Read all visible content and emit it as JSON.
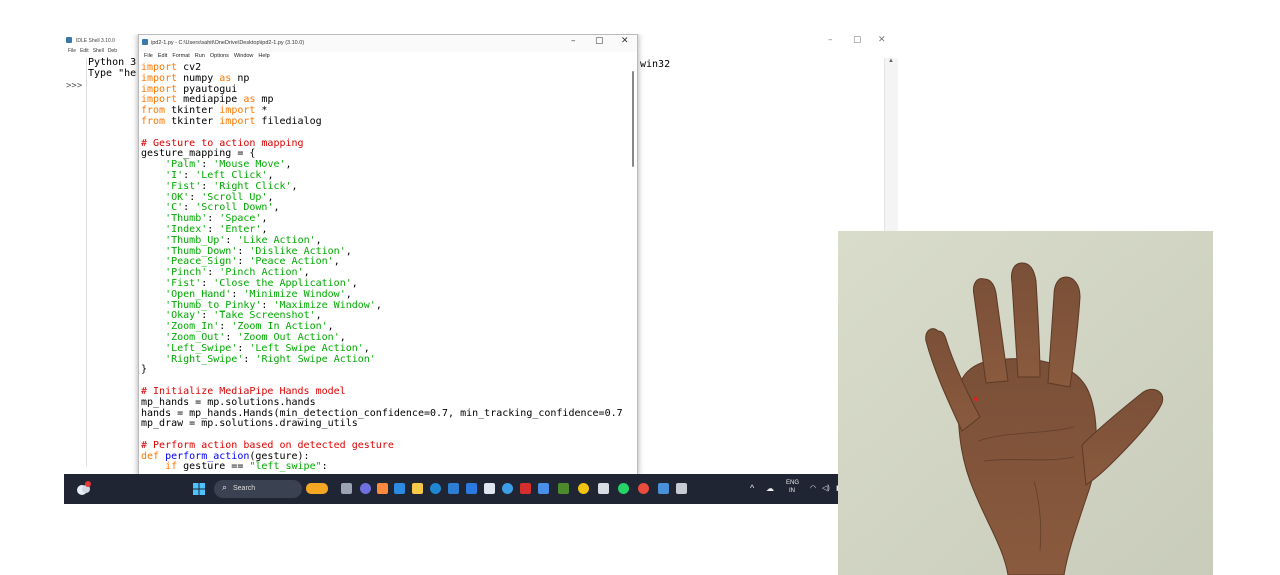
{
  "shell": {
    "title": "IDLE Shell 3.10.0",
    "menu": [
      "File",
      "Edit",
      "Shell",
      "Deb"
    ],
    "lines": [
      "Python 3",
      "Type \"he"
    ],
    "line_tail": "win32",
    "prompt": ">>>",
    "controls": {
      "minimize": "–",
      "maximize": "▢",
      "close": "✕"
    }
  },
  "editor": {
    "title": "ipd2-1.py - C:\\Users\\sahit\\OneDrive\\Desktop\\ipd2-1.py (3.10.0)",
    "menu": [
      "File",
      "Edit",
      "Format",
      "Run",
      "Options",
      "Window",
      "Help"
    ],
    "controls": {
      "minimize": "–",
      "maximize": "▢",
      "close": "✕"
    },
    "code": {
      "l1_kw": "import",
      "l1_rest": " cv2",
      "l2_kw": "import",
      "l2_mid": " numpy ",
      "l2_kw2": "as",
      "l2_rest": " np",
      "l3_kw": "import",
      "l3_rest": " pyautogui",
      "l4_kw": "import",
      "l4_mid": " mediapipe ",
      "l4_kw2": "as",
      "l4_rest": " mp",
      "l5_kw": "from",
      "l5_mid": " tkinter ",
      "l5_kw2": "import",
      "l5_rest": " *",
      "l6_kw": "from",
      "l6_mid": " tkinter ",
      "l6_kw2": "import",
      "l6_rest": " filedialog",
      "c1": "# Gesture to action mapping",
      "map_open": "gesture_mapping = {",
      "mapping": [
        {
          "k": "'Palm'",
          "v": "'Mouse Move'",
          "end": ","
        },
        {
          "k": "'I'",
          "v": "'Left Click'",
          "end": ","
        },
        {
          "k": "'Fist'",
          "v": "'Right Click'",
          "end": ","
        },
        {
          "k": "'OK'",
          "v": "'Scroll Up'",
          "end": ","
        },
        {
          "k": "'C'",
          "v": "'Scroll Down'",
          "end": ","
        },
        {
          "k": "'Thumb'",
          "v": "'Space'",
          "end": ","
        },
        {
          "k": "'Index'",
          "v": "'Enter'",
          "end": ","
        },
        {
          "k": "'Thumb_Up'",
          "v": "'Like Action'",
          "end": ","
        },
        {
          "k": "'Thumb_Down'",
          "v": "'Dislike Action'",
          "end": ","
        },
        {
          "k": "'Peace_Sign'",
          "v": "'Peace Action'",
          "end": ","
        },
        {
          "k": "'Pinch'",
          "v": "'Pinch Action'",
          "end": ","
        },
        {
          "k": "'Fist'",
          "v": "'Close the Application'",
          "end": ","
        },
        {
          "k": "'Open_Hand'",
          "v": "'Minimize Window'",
          "end": ","
        },
        {
          "k": "'Thumb_to_Pinky'",
          "v": "'Maximize Window'",
          "end": ","
        },
        {
          "k": "'Okay'",
          "v": "'Take Screenshot'",
          "end": ","
        },
        {
          "k": "'Zoom_In'",
          "v": "'Zoom In Action'",
          "end": ","
        },
        {
          "k": "'Zoom_Out'",
          "v": "'Zoom Out Action'",
          "end": ","
        },
        {
          "k": "'Left_Swipe'",
          "v": "'Left Swipe Action'",
          "end": ","
        },
        {
          "k": "'Right_Swipe'",
          "v": "'Right Swipe Action'",
          "end": ""
        }
      ],
      "map_close": "}",
      "c2": "# Initialize MediaPipe Hands model",
      "h1": "mp_hands = mp.solutions.hands",
      "h2": "hands = mp_hands.Hands(min_detection_confidence=0.7, min_tracking_confidence=0.7",
      "h3": "mp_draw = mp.solutions.drawing_utils",
      "c3": "# Perform action based on detected gesture",
      "def_kw": "def",
      "def_name": " perform_action",
      "def_rest": "(gesture):",
      "if_kw": "    if",
      "if_mid": " gesture == ",
      "if_str": "\"left_swipe\"",
      "if_rest": ":"
    }
  },
  "taskbar": {
    "search_label": "Search",
    "lang": "ENG",
    "region": "IN",
    "colors": {
      "bg": "#1f2533"
    }
  },
  "photo": {
    "description_icon": "hand-photo"
  }
}
